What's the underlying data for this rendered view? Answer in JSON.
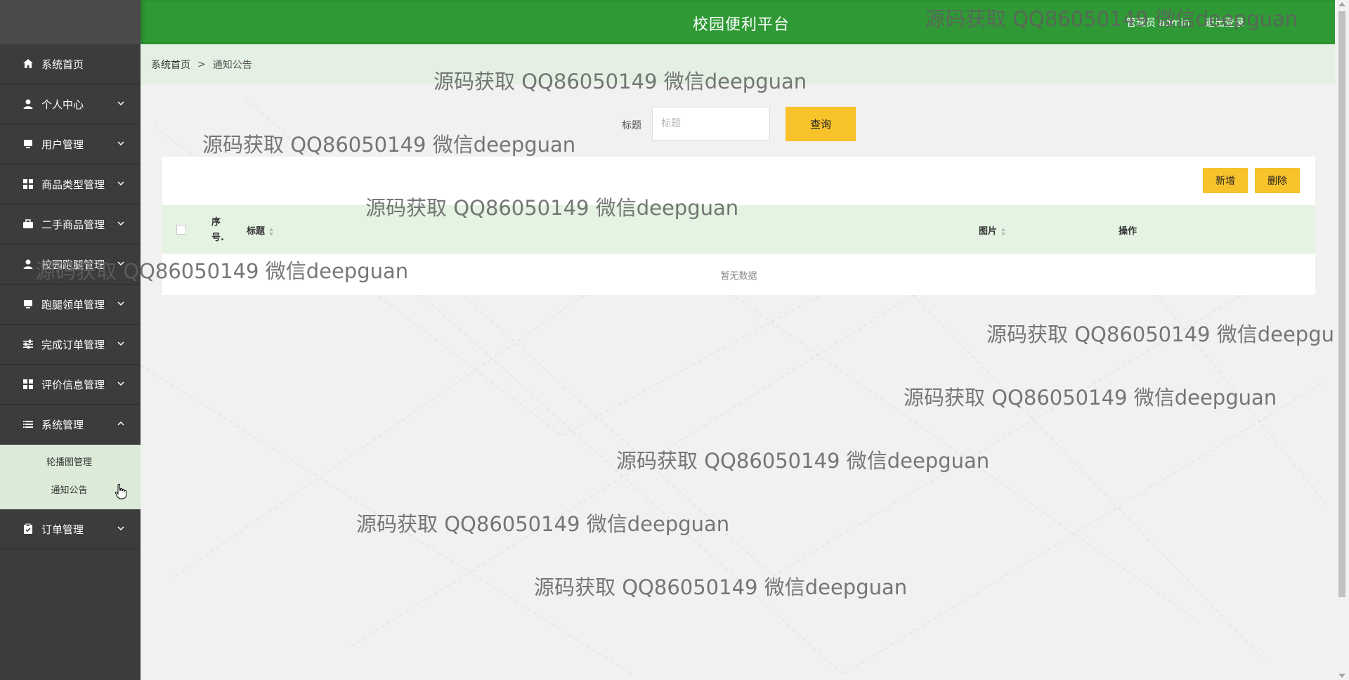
{
  "header": {
    "title": "校园便利平台",
    "user_text": "管理员 admin",
    "logout": "退出登录",
    "color": "#2f9a35"
  },
  "breadcrumb": {
    "home": "系统首页",
    "separator": ">",
    "current": "通知公告"
  },
  "sidebar": {
    "items": [
      {
        "label": "系统首页",
        "icon": "home-icon"
      },
      {
        "label": "个人中心",
        "icon": "user-icon"
      },
      {
        "label": "用户管理",
        "icon": "monitor-icon"
      },
      {
        "label": "商品类型管理",
        "icon": "grid-icon"
      },
      {
        "label": "二手商品管理",
        "icon": "briefcase-icon"
      },
      {
        "label": "校园跑腿管理",
        "icon": "user-icon"
      },
      {
        "label": "跑腿领单管理",
        "icon": "monitor-icon"
      },
      {
        "label": "完成订单管理",
        "icon": "sliders-icon"
      },
      {
        "label": "评价信息管理",
        "icon": "grid-icon"
      },
      {
        "label": "系统管理",
        "icon": "list-icon"
      },
      {
        "label": "订单管理",
        "icon": "clipboard-icon"
      }
    ],
    "system_submenu": [
      "轮播图管理",
      "通知公告"
    ]
  },
  "search": {
    "label": "标题",
    "placeholder": "标题",
    "button": "查询"
  },
  "actions": {
    "add": "新增",
    "delete": "删除"
  },
  "table": {
    "columns": {
      "index": "序号.",
      "title": "标题",
      "image": "图片",
      "operation": "操作"
    },
    "empty_text": "暂无数据"
  },
  "watermark": "源码获取 QQ86050149 微信deepguan",
  "colors": {
    "accent": "#f8c22b",
    "sidebar": "#3c3c3c",
    "submenu": "#dcebd8",
    "table_header": "#e4f3e2"
  }
}
